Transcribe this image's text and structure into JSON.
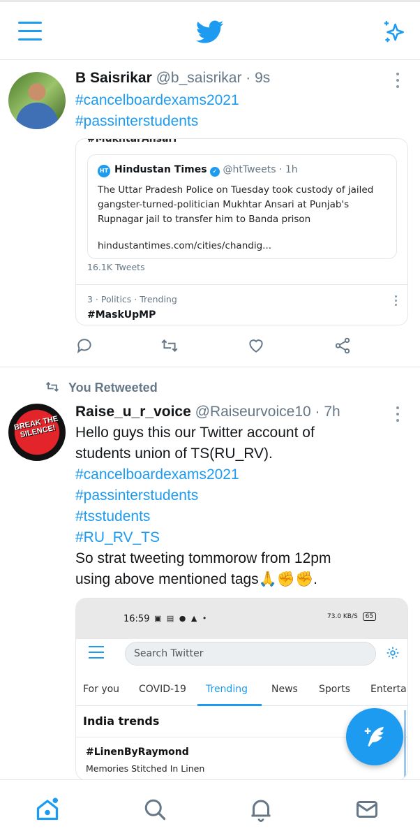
{
  "colors": {
    "accent": "#1d9bf0",
    "secondary_text": "#657786",
    "border": "#e1e8ed"
  },
  "header": {
    "menu_icon": "hamburger-menu-icon",
    "logo_icon": "twitter-bird-icon",
    "top_tweets_icon": "sparkle-icon"
  },
  "tweets": [
    {
      "author_name": "B Saisrikar",
      "handle": "@b_saisrikar",
      "time": "· 9s",
      "lines": [
        "#cancelboardexams2021",
        "#passinterstudents"
      ],
      "embedded": {
        "cut_off_text": "#MukhtarAnsari",
        "quote": {
          "source_name": "Hindustan Times",
          "logo_text": "HT",
          "source_handle": "@htTweets",
          "source_time": "· 1h",
          "body": "The Uttar Pradesh Police on Tuesday took custody of jailed gangster-turned-politician Mukhtar Ansari at Punjab's Rupnagar jail to transfer him to Banda prison",
          "link": "hindustantimes.com/cities/chandig..."
        },
        "tweet_count": "16.1K Tweets",
        "trend_meta": "3 · Politics · Trending",
        "trend_tag": "#MaskUpMP"
      },
      "actions": [
        "reply-icon",
        "retweet-icon",
        "like-icon",
        "share-icon"
      ]
    },
    {
      "retweeted_label": "You Retweeted",
      "author_name": "Raise_u_r_voice",
      "handle": "@Raiseurvoice10",
      "time": "· 7h",
      "avatar_text": "BREAK THE SILENCE!",
      "lines": [
        "Hello guys this our Twitter account of",
        "students union of TS(RU_RV).",
        "#cancelboardexams2021",
        "#passinterstudents",
        "#tsstudents",
        "#RU_RV_TS",
        "So strat tweeting tommorow  from 12pm",
        "using above mentioned tags🙏✊✊."
      ],
      "screenshot": {
        "status_time": "16:59",
        "status_icons": "▣ ▤ ● ▲ •",
        "status_right": "73.0 KB/S",
        "battery": "65",
        "search_placeholder": "Search Twitter",
        "tabs": [
          "For you",
          "COVID-19",
          "Trending",
          "News",
          "Sports",
          "Enterta"
        ],
        "active_tab": "Trending",
        "section_title": "India trends",
        "trend_name": "#LinenByRaymond",
        "trend_subtitle": "Memories Stitched In Linen"
      }
    }
  ],
  "fab": {
    "icon": "compose-tweet-icon"
  },
  "bottom_nav": [
    "home-icon",
    "search-icon",
    "notifications-icon",
    "messages-icon"
  ]
}
